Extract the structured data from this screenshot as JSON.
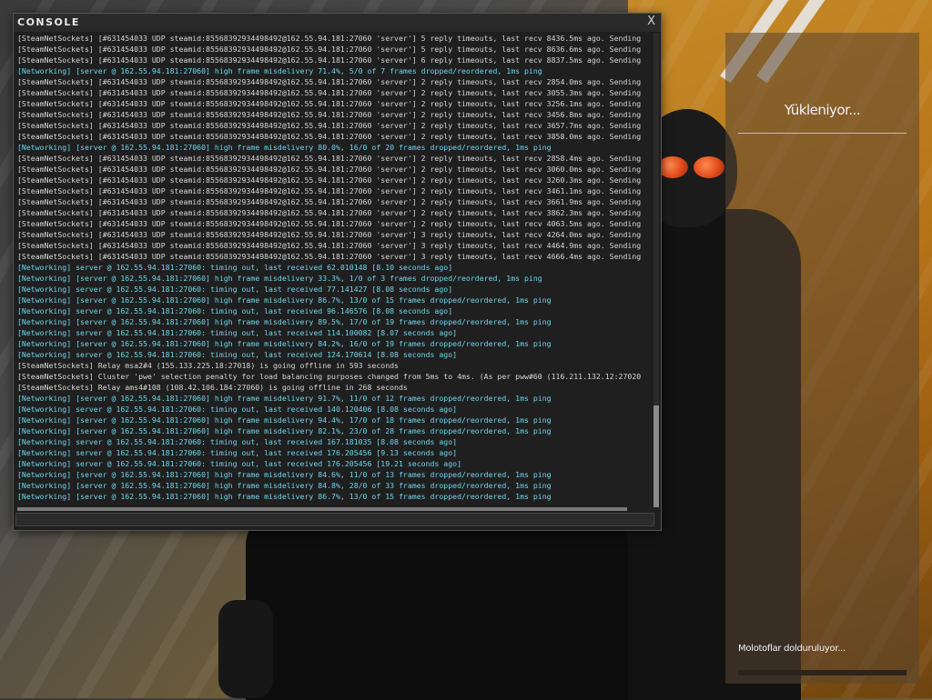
{
  "console": {
    "title": "CONSOLE",
    "close_label": "X",
    "input_value": "",
    "lines": [
      {
        "type": "sns",
        "text": "[SteamNetSockets] [#631454033 UDP steamid:85568392934498492@162.55.94.181:27060 'server'] 5 reply timeouts, last recv 8436.5ms ago.  Sending"
      },
      {
        "type": "sns",
        "text": "[SteamNetSockets] [#631454033 UDP steamid:85568392934498492@162.55.94.181:27060 'server'] 5 reply timeouts, last recv 8636.6ms ago.  Sending"
      },
      {
        "type": "sns",
        "text": "[SteamNetSockets] [#631454033 UDP steamid:85568392934498492@162.55.94.181:27060 'server'] 6 reply timeouts, last recv 8837.5ms ago.  Sending"
      },
      {
        "type": "net",
        "text": "[Networking] [server @ 162.55.94.181:27060] high frame misdelivery 71.4%, 5/0 of 7 frames dropped/reordered, 1ms ping"
      },
      {
        "type": "sns",
        "text": "[SteamNetSockets] [#631454033 UDP steamid:85568392934498492@162.55.94.181:27060 'server'] 2 reply timeouts, last recv 2854.0ms ago.  Sending"
      },
      {
        "type": "sns",
        "text": "[SteamNetSockets] [#631454033 UDP steamid:85568392934498492@162.55.94.181:27060 'server'] 2 reply timeouts, last recv 3055.3ms ago.  Sending"
      },
      {
        "type": "sns",
        "text": "[SteamNetSockets] [#631454033 UDP steamid:85568392934498492@162.55.94.181:27060 'server'] 2 reply timeouts, last recv 3256.1ms ago.  Sending"
      },
      {
        "type": "sns",
        "text": "[SteamNetSockets] [#631454033 UDP steamid:85568392934498492@162.55.94.181:27060 'server'] 2 reply timeouts, last recv 3456.8ms ago.  Sending"
      },
      {
        "type": "sns",
        "text": "[SteamNetSockets] [#631454033 UDP steamid:85568392934498492@162.55.94.181:27060 'server'] 2 reply timeouts, last recv 3657.7ms ago.  Sending"
      },
      {
        "type": "sns",
        "text": "[SteamNetSockets] [#631454033 UDP steamid:85568392934498492@162.55.94.181:27060 'server'] 2 reply timeouts, last recv 3858.0ms ago.  Sending"
      },
      {
        "type": "net",
        "text": "[Networking] [server @ 162.55.94.181:27060] high frame misdelivery 80.0%, 16/0 of 20 frames dropped/reordered, 1ms ping"
      },
      {
        "type": "sns",
        "text": "[SteamNetSockets] [#631454033 UDP steamid:85568392934498492@162.55.94.181:27060 'server'] 2 reply timeouts, last recv 2858.4ms ago.  Sending"
      },
      {
        "type": "sns",
        "text": "[SteamNetSockets] [#631454033 UDP steamid:85568392934498492@162.55.94.181:27060 'server'] 2 reply timeouts, last recv 3060.0ms ago.  Sending"
      },
      {
        "type": "sns",
        "text": "[SteamNetSockets] [#631454033 UDP steamid:85568392934498492@162.55.94.181:27060 'server'] 2 reply timeouts, last recv 3260.3ms ago.  Sending"
      },
      {
        "type": "sns",
        "text": "[SteamNetSockets] [#631454033 UDP steamid:85568392934498492@162.55.94.181:27060 'server'] 2 reply timeouts, last recv 3461.1ms ago.  Sending"
      },
      {
        "type": "sns",
        "text": "[SteamNetSockets] [#631454033 UDP steamid:85568392934498492@162.55.94.181:27060 'server'] 2 reply timeouts, last recv 3661.9ms ago.  Sending"
      },
      {
        "type": "sns",
        "text": "[SteamNetSockets] [#631454033 UDP steamid:85568392934498492@162.55.94.181:27060 'server'] 2 reply timeouts, last recv 3862.3ms ago.  Sending"
      },
      {
        "type": "sns",
        "text": "[SteamNetSockets] [#631454033 UDP steamid:85568392934498492@162.55.94.181:27060 'server'] 2 reply timeouts, last recv 4063.5ms ago.  Sending"
      },
      {
        "type": "sns",
        "text": "[SteamNetSockets] [#631454033 UDP steamid:85568392934498492@162.55.94.181:27060 'server'] 3 reply timeouts, last recv 4264.0ms ago.  Sending"
      },
      {
        "type": "sns",
        "text": "[SteamNetSockets] [#631454033 UDP steamid:85568392934498492@162.55.94.181:27060 'server'] 3 reply timeouts, last recv 4464.9ms ago.  Sending"
      },
      {
        "type": "sns",
        "text": "[SteamNetSockets] [#631454033 UDP steamid:85568392934498492@162.55.94.181:27060 'server'] 3 reply timeouts, last recv 4666.4ms ago.  Sending"
      },
      {
        "type": "net",
        "text": "[Networking] server @ 162.55.94.181:27060: timing out, last received 62.010148 [8.10 seconds ago]"
      },
      {
        "type": "net",
        "text": "[Networking] [server @ 162.55.94.181:27060] high frame misdelivery 33.3%, 1/0 of 3 frames dropped/reordered, 1ms ping"
      },
      {
        "type": "net",
        "text": "[Networking] server @ 162.55.94.181:27060: timing out, last received 77.141427 [8.08 seconds ago]"
      },
      {
        "type": "net",
        "text": "[Networking] [server @ 162.55.94.181:27060] high frame misdelivery 86.7%, 13/0 of 15 frames dropped/reordered, 1ms ping"
      },
      {
        "type": "net",
        "text": "[Networking] server @ 162.55.94.181:27060: timing out, last received 96.146576 [8.08 seconds ago]"
      },
      {
        "type": "net",
        "text": "[Networking] [server @ 162.55.94.181:27060] high frame misdelivery 89.5%, 17/0 of 19 frames dropped/reordered, 1ms ping"
      },
      {
        "type": "net",
        "text": "[Networking] server @ 162.55.94.181:27060: timing out, last received 114.100082 [8.07 seconds ago]"
      },
      {
        "type": "net",
        "text": "[Networking] [server @ 162.55.94.181:27060] high frame misdelivery 84.2%, 16/0 of 19 frames dropped/reordered, 1ms ping"
      },
      {
        "type": "net",
        "text": "[Networking] server @ 162.55.94.181:27060: timing out, last received 124.170614 [8.08 seconds ago]"
      },
      {
        "type": "sns",
        "text": "[SteamNetSockets] Relay msa2#4 (155.133.225.18:27018) is going offline in 593 seconds"
      },
      {
        "type": "sns",
        "text": "[SteamNetSockets] Cluster 'pwe' selection penalty for load balancing purposes changed from 5ms to 4ms.  (As per pww#60 (116.211.132.12:27020"
      },
      {
        "type": "sns",
        "text": "[SteamNetSockets] Relay ams4#108 (108.42.106.184:27060) is going offline in 268 seconds"
      },
      {
        "type": "net",
        "text": "[Networking] [server @ 162.55.94.181:27060] high frame misdelivery 91.7%, 11/0 of 12 frames dropped/reordered, 1ms ping"
      },
      {
        "type": "net",
        "text": "[Networking] server @ 162.55.94.181:27060: timing out, last received 140.120406 [8.08 seconds ago]"
      },
      {
        "type": "net",
        "text": "[Networking] [server @ 162.55.94.181:27060] high frame misdelivery 94.4%, 17/0 of 18 frames dropped/reordered, 1ms ping"
      },
      {
        "type": "net",
        "text": "[Networking] [server @ 162.55.94.181:27060] high frame misdelivery 82.1%, 23/0 of 28 frames dropped/reordered, 1ms ping"
      },
      {
        "type": "net",
        "text": "[Networking] server @ 162.55.94.181:27060: timing out, last received 167.181035 [8.08 seconds ago]"
      },
      {
        "type": "net",
        "text": "[Networking] server @ 162.55.94.181:27060: timing out, last received 176.205456 [9.13 seconds ago]"
      },
      {
        "type": "net",
        "text": "[Networking] server @ 162.55.94.181:27060: timing out, last received 176.205456 [19.21 seconds ago]"
      },
      {
        "type": "net",
        "text": "[Networking] [server @ 162.55.94.181:27060] high frame misdelivery 84.6%, 11/0 of 13 frames dropped/reordered, 1ms ping"
      },
      {
        "type": "net",
        "text": "[Networking] [server @ 162.55.94.181:27060] high frame misdelivery 84.8%, 28/0 of 33 frames dropped/reordered, 1ms ping"
      },
      {
        "type": "net",
        "text": "[Networking] [server @ 162.55.94.181:27060] high frame misdelivery 86.7%, 13/0 of 15 frames dropped/reordered, 1ms ping"
      }
    ]
  },
  "loading": {
    "title": "Yükleniyor...",
    "status": "Molotoflar dolduruluyor...",
    "progress_fraction": 0.0
  },
  "colors": {
    "sns_text": "#d6d6d6",
    "net_text": "#6fd5ec"
  }
}
